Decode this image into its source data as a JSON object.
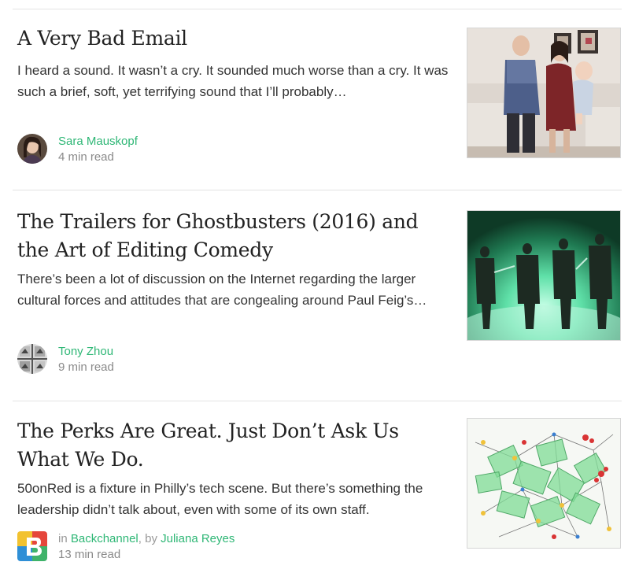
{
  "articles": [
    {
      "title": "A Very Bad Email",
      "excerpt": "I heard a sound. It wasn’t a cry. It sounded much worse than a cry. It was such a brief, soft, yet terrifying sound that I’ll probably…",
      "author": "Sara Mauskopf",
      "read_time": "4 min read",
      "image_icon": "family-photo-image",
      "avatar_icon": "author-portrait-icon"
    },
    {
      "title": "The Trailers for Ghostbusters (2016) and the Art of Editing Comedy",
      "excerpt": "There’s been a lot of discussion on the Internet regarding the larger cultural forces and attitudes that are congealing around Paul Feig’s…",
      "author": "Tony Zhou",
      "read_time": "9 min read",
      "image_icon": "ghostbusters-still-image",
      "avatar_icon": "film-frames-avatar-icon"
    },
    {
      "title": "The Perks Are Great. Just Don’t Ask Us What We Do.",
      "excerpt": "50onRed is a fixture in Philly’s tech scene. But there’s something the leadership didn’t talk about, even with some of its own staff.",
      "publication_prefix": "in",
      "publication": "Backchannel",
      "by_prefix": ", by",
      "author": "Juliana Reyes",
      "read_time": "13 min read",
      "image_icon": "network-diagram-illustration",
      "avatar_icon": "backchannel-logo-icon"
    }
  ],
  "colors": {
    "link_green": "#2fb776",
    "divider": "#e3e3e3",
    "title_text": "#222222",
    "body_text": "#333333",
    "meta_text": "#8a8a8a"
  }
}
